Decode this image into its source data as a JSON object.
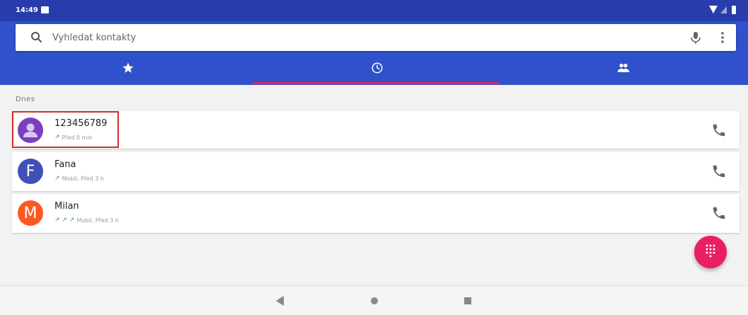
{
  "status_bar": {
    "time": "14:49",
    "icons": [
      "notification-icon",
      "wifi-icon",
      "signal-icon",
      "battery-icon"
    ]
  },
  "search": {
    "placeholder": "Vyhledat kontakty",
    "value": "",
    "icons": [
      "search-icon",
      "mic-icon",
      "more-vert-icon"
    ]
  },
  "tabs": [
    {
      "icon": "star-icon",
      "selected": false
    },
    {
      "icon": "clock-icon",
      "selected": true
    },
    {
      "icon": "contacts-icon",
      "selected": false
    }
  ],
  "section_header": "Dnes",
  "calls": [
    {
      "name": "123456789",
      "detail": "Před 0 min",
      "arrows": "↗",
      "avatar_letter": "",
      "avatar_color": "#7b3fbf"
    },
    {
      "name": "Fana",
      "detail": "Mobil, Před 3 h",
      "arrows": "↗",
      "avatar_letter": "F",
      "avatar_color": "#3f51b5"
    },
    {
      "name": "Milan",
      "detail": "Mobil, Před 3 h",
      "arrows": "↗ ↗ ↗",
      "avatar_letter": "M",
      "avatar_color": "#ff5722"
    }
  ],
  "colors": {
    "status_bar": "#283dab",
    "app_bar": "#2f52cc",
    "accent": "#e91e63",
    "outgoing_arrow": "#43a047",
    "highlight": "#d32f2f"
  },
  "fab": {
    "icon": "dialpad-icon"
  },
  "nav": {
    "icons": [
      "back-icon",
      "home-icon",
      "recents-icon"
    ]
  }
}
